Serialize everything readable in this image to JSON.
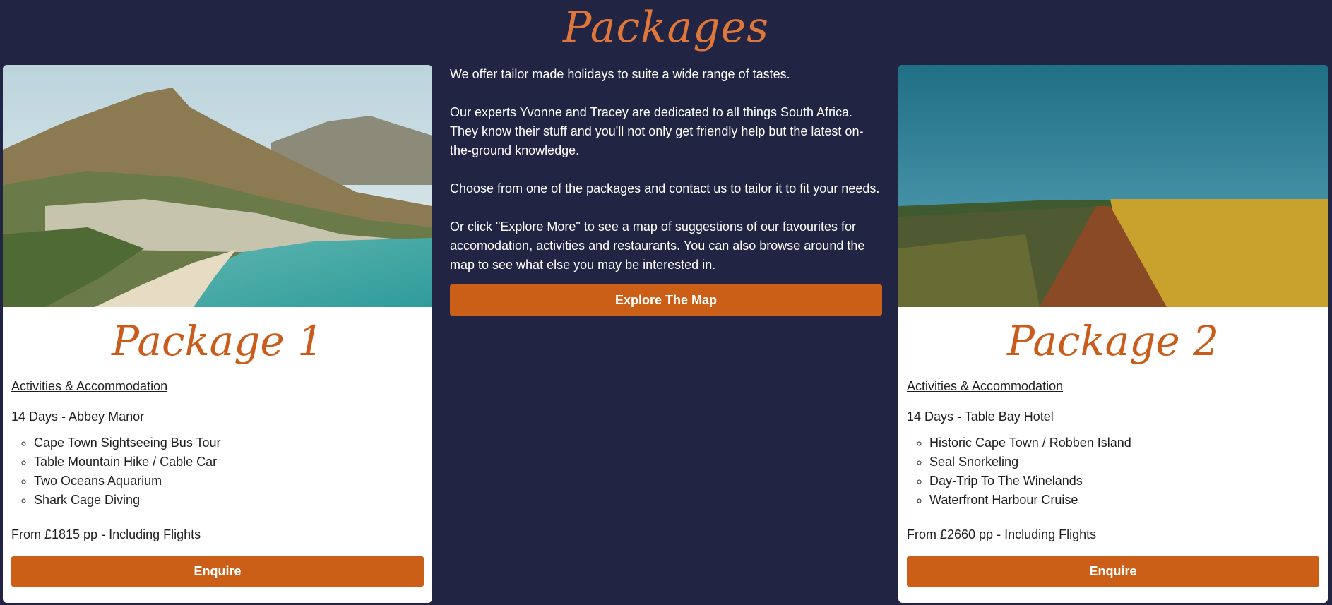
{
  "page": {
    "title": "Packages"
  },
  "colors": {
    "background": "#222444",
    "accent": "#cc5f17",
    "title": "#e0773a",
    "card": "#ffffff"
  },
  "intro": {
    "paragraphs": [
      "We offer tailor made holidays to suite a wide range of tastes.",
      "Our experts Yvonne and Tracey are dedicated to all things South Africa. They know their stuff and you'll not only get friendly help but the latest on-the-ground knowledge.",
      "Choose from one of the packages and contact us to tailor it to fit your needs.",
      "Or click \"Explore More\" to see a map of suggestions of our favourites for accomodation, activities and restaurants. You can also browse around the map to see what else you may be interested in."
    ],
    "button_label": "Explore The Map"
  },
  "packages": [
    {
      "title": "Package 1",
      "image": "coastal-bay-photo",
      "section_label": "Activities & Accommodation",
      "duration": "14 Days - Abbey Manor",
      "activities": [
        "Cape Town Sightseeing Bus Tour",
        "Table Mountain Hike / Cable Car",
        "Two Oceans Aquarium",
        "Shark Cage Diving"
      ],
      "price": "From £1815 pp - Including Flights",
      "button_label": "Enquire"
    },
    {
      "title": "Package 2",
      "image": "countryside-road-photo",
      "section_label": "Activities & Accommodation",
      "duration": "14 Days - Table Bay Hotel",
      "activities": [
        "Historic Cape Town / Robben Island",
        "Seal Snorkeling",
        "Day-Trip To The Winelands",
        "Waterfront Harbour Cruise"
      ],
      "price": "From £2660 pp - Including Flights",
      "button_label": "Enquire"
    }
  ]
}
